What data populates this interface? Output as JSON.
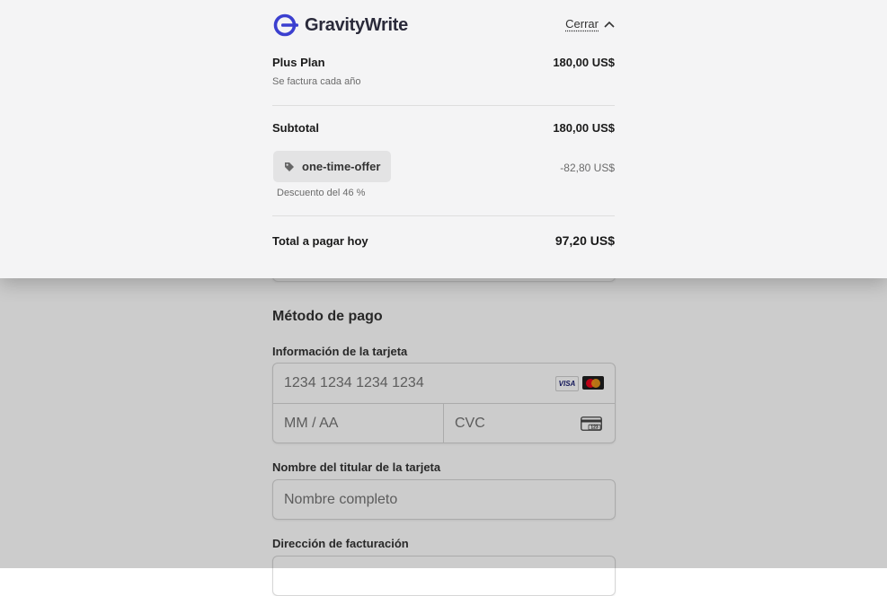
{
  "brand": {
    "name": "GravityWrite",
    "color": "#3b3fcf"
  },
  "summary": {
    "close_label": "Cerrar",
    "plan": {
      "name": "Plus Plan",
      "price": "180,00 US$",
      "billing_note": "Se factura cada año"
    },
    "subtotal": {
      "label": "Subtotal",
      "value": "180,00 US$"
    },
    "promo": {
      "code": "one-time-offer",
      "amount": "-82,80 US$",
      "note": "Descuento del 46 %"
    },
    "total": {
      "label": "Total a pagar hoy",
      "value": "97,20 US$"
    }
  },
  "payment": {
    "section_title": "Método de pago",
    "card_info_label": "Información de la tarjeta",
    "card_number_placeholder": "1234 1234 1234 1234",
    "expiry_placeholder": "MM / AA",
    "cvc_placeholder": "CVC",
    "card_brands": [
      "visa-icon",
      "mastercard-icon"
    ],
    "cardholder_label": "Nombre del titular de la tarjeta",
    "cardholder_placeholder": "Nombre completo",
    "billing_address_label": "Dirección de facturación"
  },
  "colors": {
    "panel_bg": "#f4f4f5",
    "overlay": "rgba(0,0,0,0.20)",
    "chip_bg": "#e3e3e4"
  }
}
